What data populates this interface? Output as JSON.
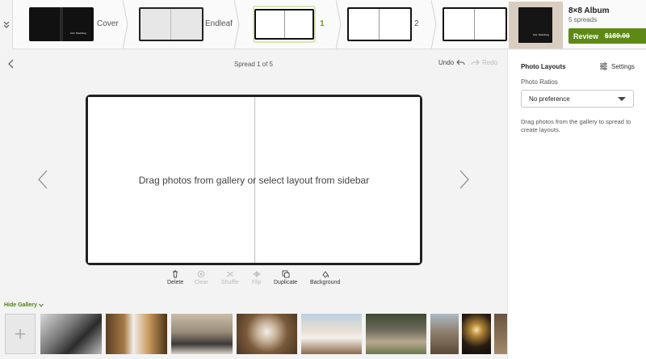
{
  "spreads": [
    {
      "label": "Cover"
    },
    {
      "label": "Endleaf"
    },
    {
      "label": "1"
    },
    {
      "label": "2"
    },
    {
      "label": ""
    }
  ],
  "selected_spread": "1",
  "album": {
    "title": "8×8 Album",
    "subtitle": "5 spreads",
    "review_label": "Review",
    "price": "$189.00"
  },
  "editor": {
    "spread_label": "Spread 1 of 5",
    "undo_label": "Undo",
    "redo_label": "Redo",
    "drop_message": "Drag photos from gallery or select layout from sidebar"
  },
  "tools": {
    "delete": "Delete",
    "clear": "Clear",
    "shuffle": "Shuffle",
    "flip": "Flip",
    "duplicate": "Duplicate",
    "background": "Background"
  },
  "sidebar": {
    "title": "Photo Layouts",
    "settings_label": "Settings",
    "ratio_label": "Photo Ratios",
    "ratio_value": "No preference",
    "help_text": "Drag photos from the gallery to spread to create layouts."
  },
  "gallery": {
    "hide_label": "Hide Gallery"
  },
  "colors": {
    "accent": "#5c8a14",
    "selected_label": "#6a9a10"
  }
}
